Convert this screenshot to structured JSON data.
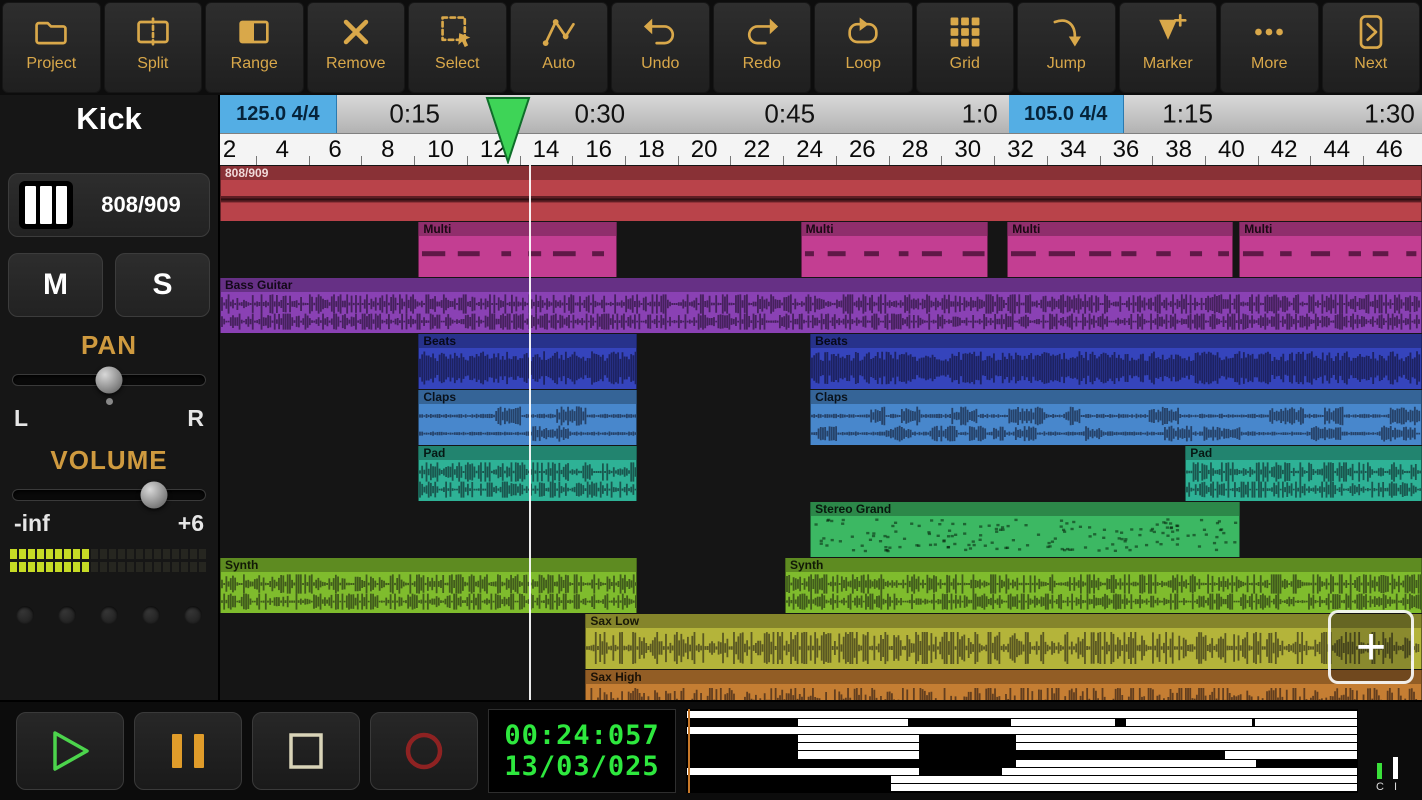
{
  "toolbar": {
    "items": [
      {
        "id": "project",
        "label": "Project",
        "icon": "folder-icon"
      },
      {
        "id": "split",
        "label": "Split",
        "icon": "split-icon"
      },
      {
        "id": "range",
        "label": "Range",
        "icon": "range-icon"
      },
      {
        "id": "remove",
        "label": "Remove",
        "icon": "remove-x-icon"
      },
      {
        "id": "select",
        "label": "Select",
        "icon": "select-marquee-icon"
      },
      {
        "id": "auto",
        "label": "Auto",
        "icon": "automation-curve-icon"
      },
      {
        "id": "undo",
        "label": "Undo",
        "icon": "undo-arrow-icon"
      },
      {
        "id": "redo",
        "label": "Redo",
        "icon": "redo-arrow-icon"
      },
      {
        "id": "loop",
        "label": "Loop",
        "icon": "loop-icon"
      },
      {
        "id": "grid",
        "label": "Grid",
        "icon": "grid-icon"
      },
      {
        "id": "jump",
        "label": "Jump",
        "icon": "jump-arrow-icon"
      },
      {
        "id": "marker",
        "label": "Marker",
        "icon": "marker-add-icon"
      },
      {
        "id": "more",
        "label": "More",
        "icon": "more-dots-icon"
      },
      {
        "id": "next",
        "label": "Next",
        "icon": "next-page-icon"
      }
    ]
  },
  "sidebar": {
    "track_name": "Kick",
    "instrument": "808/909",
    "mute": "M",
    "solo": "S",
    "pan_label": "PAN",
    "pan_left": "L",
    "pan_right": "R",
    "pan_value_pct": 50,
    "volume_label": "VOLUME",
    "volume_min": "-inf",
    "volume_max": "+6",
    "volume_value_pct": 73,
    "meter": {
      "rows": 2,
      "segments": 22,
      "lit": 9
    },
    "page_dots": 5
  },
  "timeline": {
    "tempo_markers": [
      {
        "text": "125.0 4/4",
        "left_pct": 0,
        "width_pct": 9.7
      },
      {
        "text": "105.0 4/4",
        "left_pct": 65.6,
        "width_pct": 9.6
      }
    ],
    "time_labels": [
      {
        "text": "0:15",
        "pct": 16.2
      },
      {
        "text": "0:30",
        "pct": 31.6
      },
      {
        "text": "0:45",
        "pct": 47.4
      },
      {
        "text": "1:0",
        "pct": 63.2
      },
      {
        "text": "1:15",
        "pct": 80.5
      },
      {
        "text": "1:30",
        "pct": 97.3
      }
    ],
    "bar_numbers": [
      "2",
      "4",
      "6",
      "8",
      "10",
      "12",
      "14",
      "16",
      "18",
      "20",
      "22",
      "24",
      "26",
      "28",
      "30",
      "32",
      "34",
      "36",
      "38",
      "40",
      "42",
      "44",
      "46"
    ],
    "playhead": {
      "line_pct": 25.7,
      "triangle_pct": 24.0
    }
  },
  "tracks": [
    {
      "name": "808/909",
      "color": "#b9434a",
      "label_light": true,
      "wave": "band",
      "clips": [
        [
          0,
          100
        ]
      ]
    },
    {
      "name": "Multi",
      "color": "#c33e92",
      "wave": "midi",
      "clips": [
        [
          16.5,
          33.0
        ],
        [
          48.3,
          63.9
        ],
        [
          65.5,
          84.3
        ],
        [
          84.8,
          100
        ]
      ]
    },
    {
      "name": "Bass Guitar",
      "color": "#8a41b4",
      "wave": "stereo",
      "clips": [
        [
          0,
          100
        ]
      ]
    },
    {
      "name": "Beats",
      "color": "#3544bc",
      "wave": "dense",
      "clips": [
        [
          16.5,
          34.7
        ],
        [
          49.1,
          100
        ]
      ]
    },
    {
      "name": "Claps",
      "color": "#4887cc",
      "wave": "sparse",
      "clips": [
        [
          16.5,
          34.7
        ],
        [
          49.1,
          100
        ]
      ]
    },
    {
      "name": "Pad",
      "color": "#2eb296",
      "wave": "stereo",
      "clips": [
        [
          16.5,
          34.7
        ],
        [
          80.3,
          100
        ]
      ]
    },
    {
      "name": "Stereo Grand",
      "color": "#3cb863",
      "wave": "dots",
      "clips": [
        [
          49.1,
          84.9
        ]
      ]
    },
    {
      "name": "Synth",
      "color": "#7fbc2d",
      "wave": "stereo",
      "clips": [
        [
          0,
          34.7
        ],
        [
          47.0,
          100
        ]
      ]
    },
    {
      "name": "Sax Low",
      "color": "#b4b43a",
      "wave": "mono",
      "clips": [
        [
          30.4,
          100
        ]
      ]
    },
    {
      "name": "Sax High",
      "color": "#c57e33",
      "wave": "mono",
      "clips": [
        [
          30.4,
          100
        ]
      ]
    }
  ],
  "add_track_label": "+",
  "transport": {
    "time": "00:24:057",
    "date": "13/03/025",
    "meter_c": "C",
    "meter_i": "I"
  },
  "colors": {
    "accent_gold": "#d9a84a",
    "tempo_blue": "#54aee4",
    "playhead_green": "#3ed457",
    "lcd_green": "#2ee83e"
  }
}
